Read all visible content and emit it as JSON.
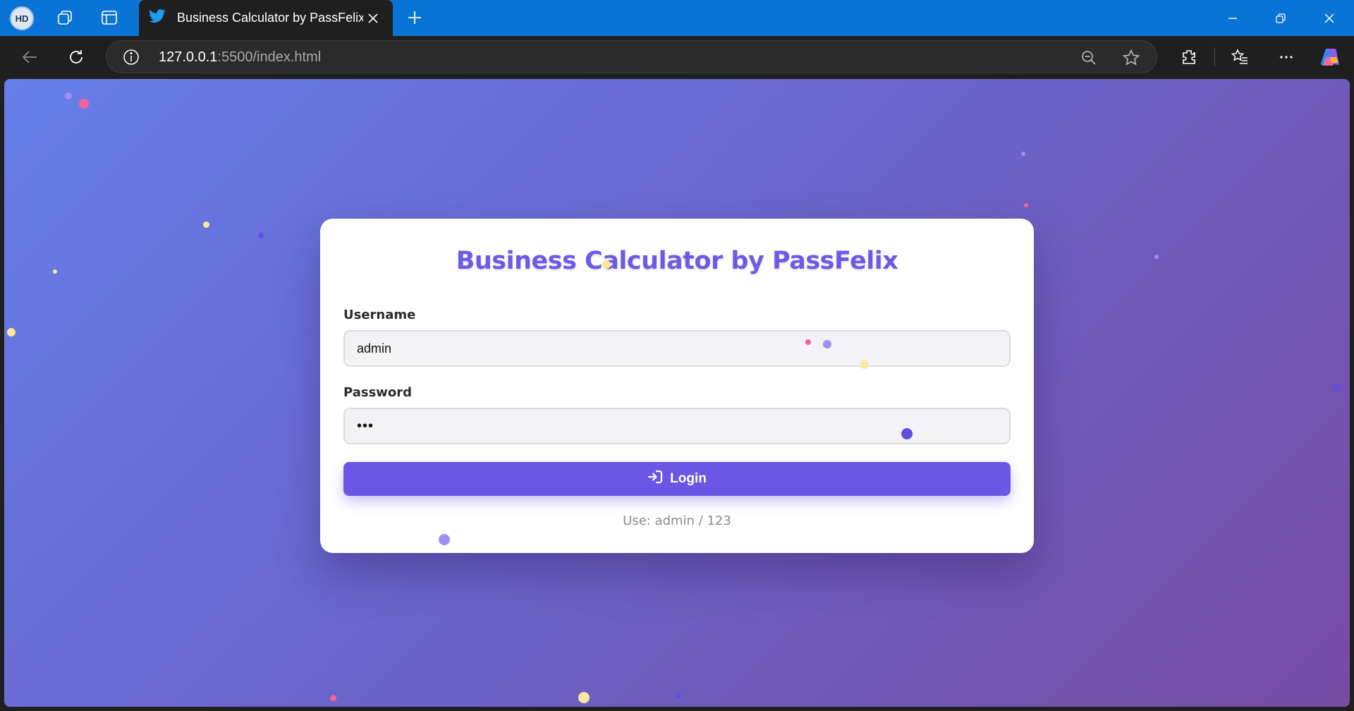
{
  "browser": {
    "profile_initials": "HD",
    "tab": {
      "title": "Business Calculator by PassFelix"
    },
    "address": {
      "host": "127.0.0.1",
      "path": ":5500/index.html"
    }
  },
  "page": {
    "title": "Business Calculator by PassFelix",
    "username": {
      "label": "Username",
      "value": "admin"
    },
    "password": {
      "label": "Password",
      "value": "•••"
    },
    "login_button": "Login",
    "hint": "Use: admin / 123",
    "colors": {
      "accent": "#6b57e6",
      "title": "#6a5ce6",
      "background_start": "#667eea",
      "background_end": "#764ba2",
      "dot_pink": "#f0649a",
      "dot_yellow": "#fbe7a0",
      "dot_lavender": "#9f8ff2",
      "dot_indigo": "#5f4fe0"
    }
  }
}
